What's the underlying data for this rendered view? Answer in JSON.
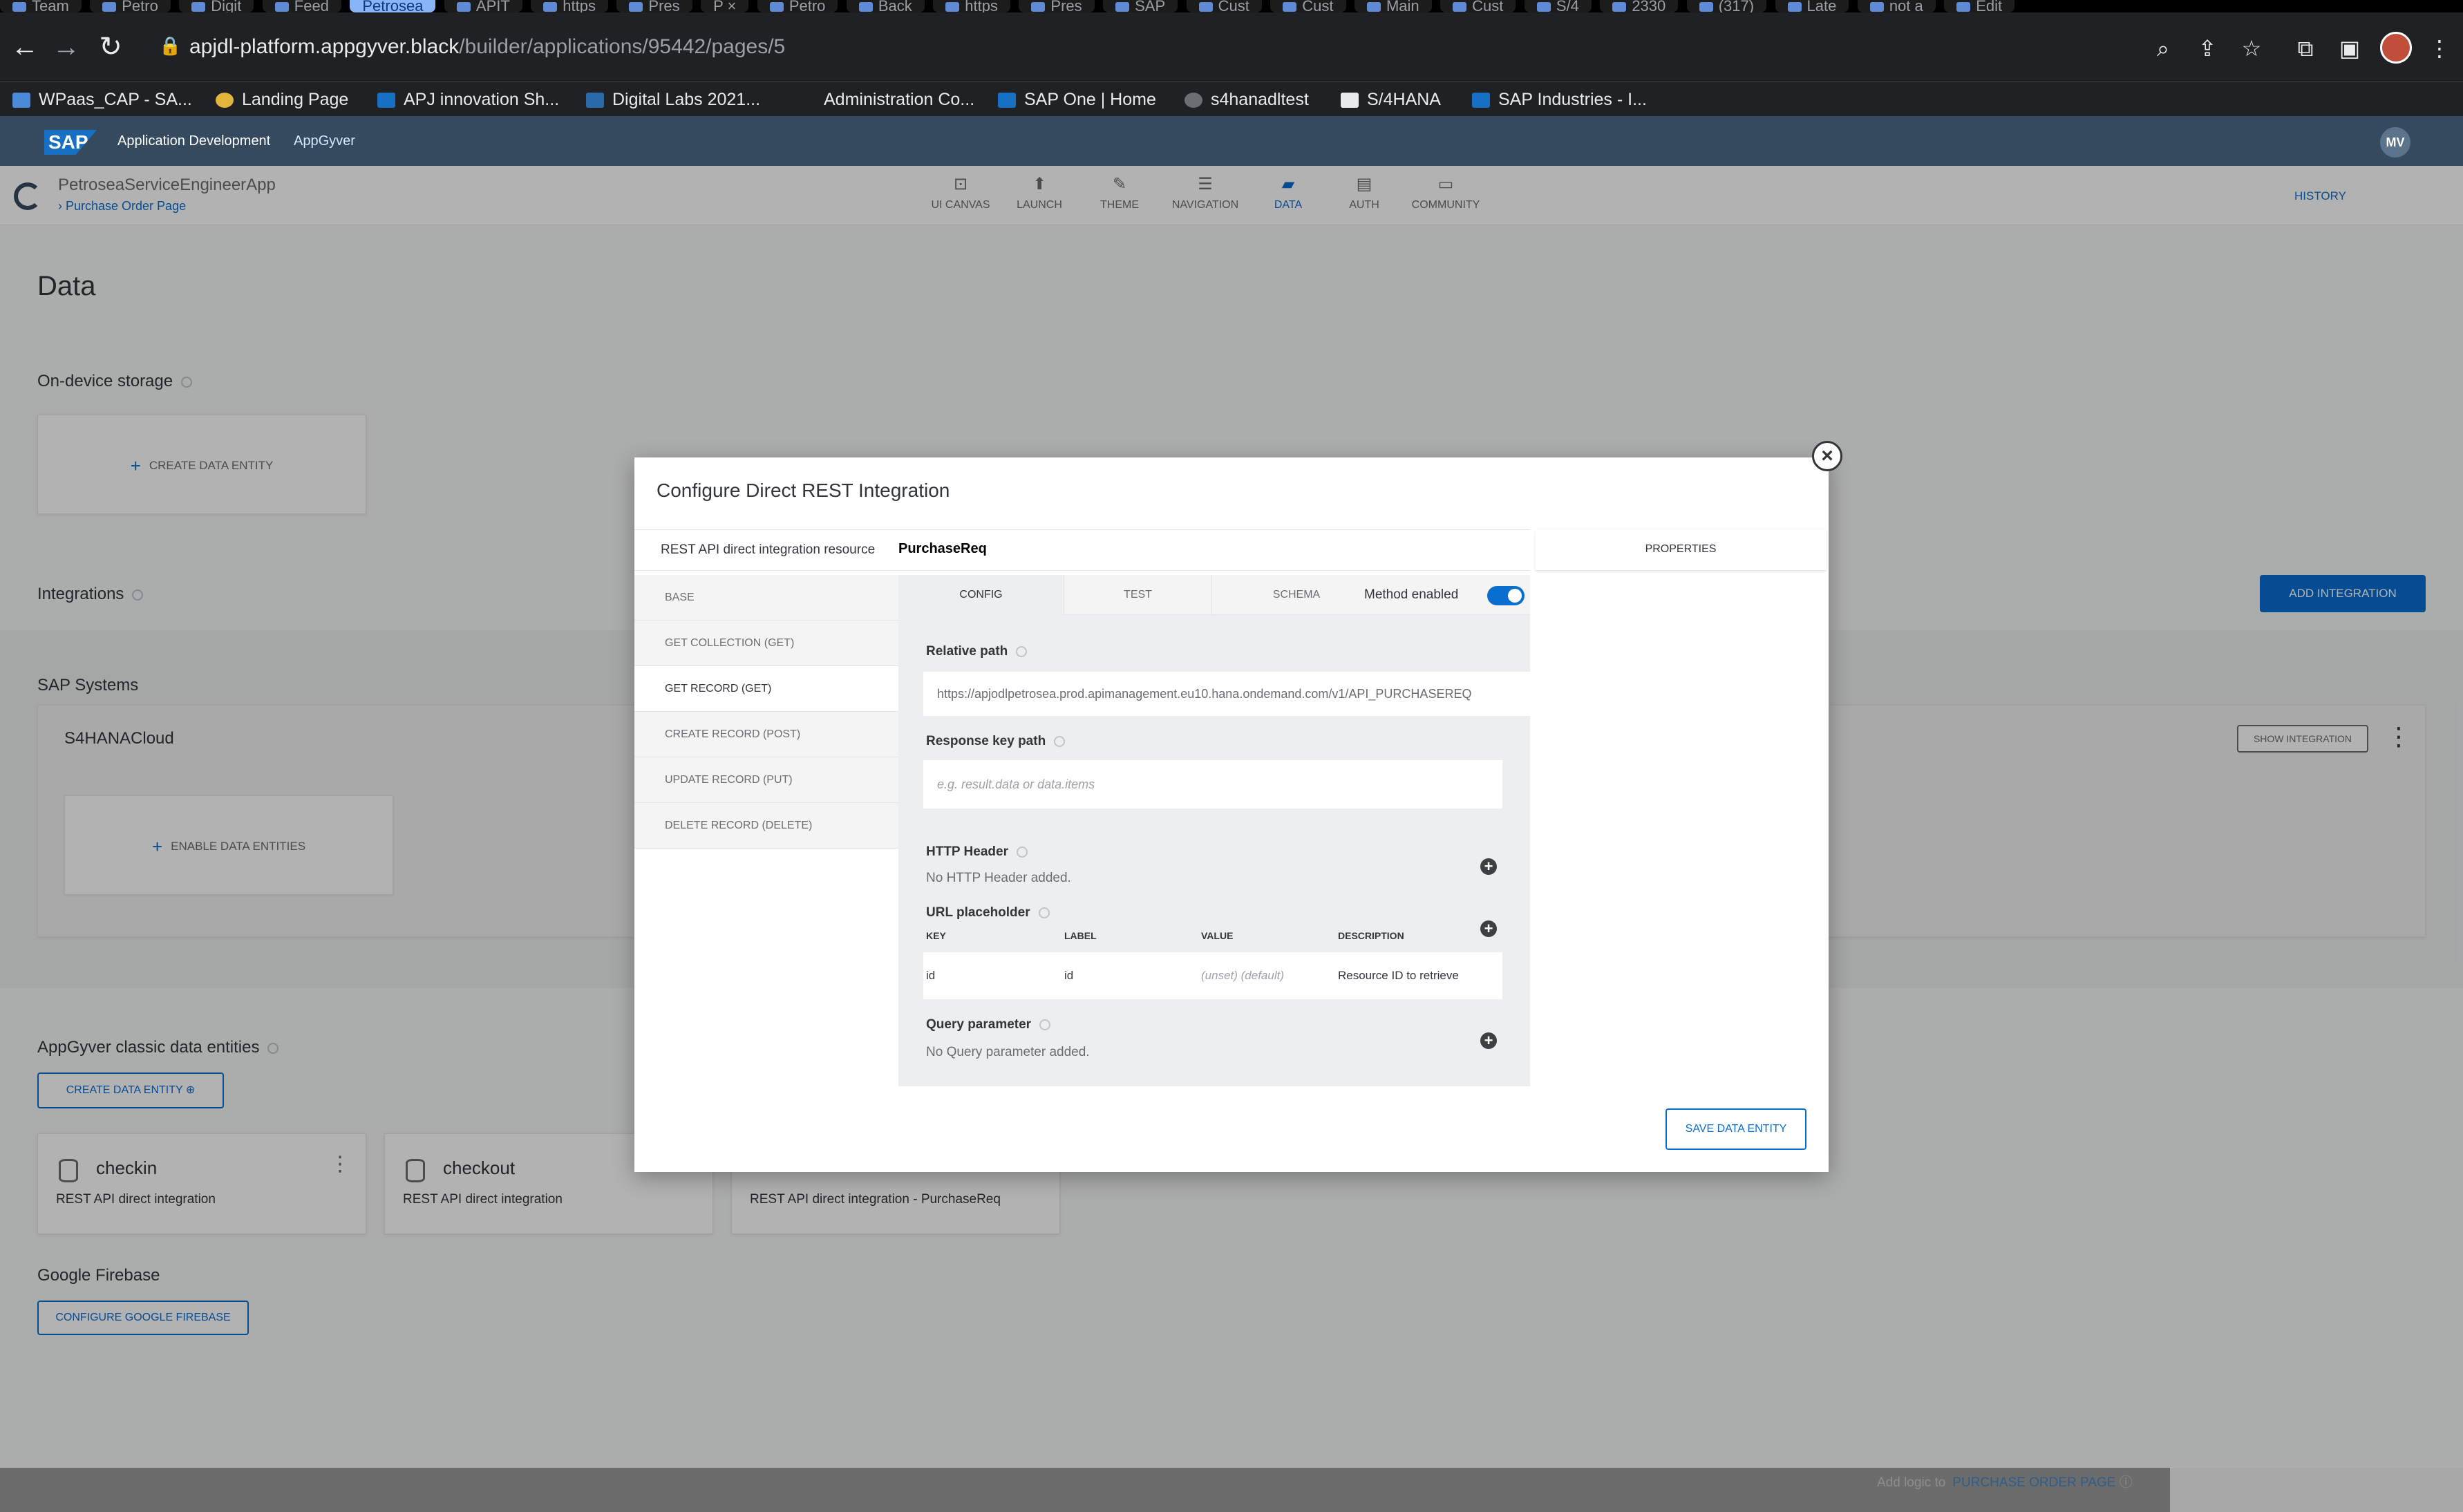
{
  "browser": {
    "tabs": [
      "Team",
      "Petro",
      "Digit",
      "Feed",
      "Petrosea",
      "APIT",
      "https",
      "Pres",
      "P",
      "Petro",
      "Back",
      "https",
      "Pres",
      "SAP",
      "Cust",
      "Cust",
      "Main",
      "Cust",
      "S/4",
      "2330",
      "(317)",
      "Late",
      "not a",
      "Edit"
    ],
    "url_host": "apjdl-platform.appgyver.black",
    "url_path": "/builder/applications/95442/pages/5",
    "bookmarks": [
      "WPaas_CAP - SA...",
      "Landing Page",
      "APJ innovation Sh...",
      "Digital Labs 2021...",
      "Administration Co...",
      "SAP One | Home",
      "s4hanadltest",
      "S/4HANA",
      "SAP Industries - I..."
    ]
  },
  "shell": {
    "logo": "SAP",
    "title": "Application Development",
    "subtitle": "AppGyver",
    "user_initials": "MV"
  },
  "app": {
    "name": "PetroseaServiceEngineerApp",
    "page": "Purchase Order Page",
    "nav": [
      "UI CANVAS",
      "LAUNCH",
      "THEME",
      "NAVIGATION",
      "DATA",
      "AUTH",
      "COMMUNITY"
    ],
    "history": "HISTORY"
  },
  "page": {
    "title": "Data",
    "on_device_storage": "On-device storage",
    "create_data_entity": "CREATE DATA ENTITY",
    "integrations": "Integrations",
    "add_integration": "ADD INTEGRATION",
    "sap_systems": "SAP Systems",
    "system_name": "S4HANACloud",
    "show_integration": "SHOW INTEGRATION",
    "enable_data_entities": "ENABLE DATA ENTITIES",
    "classic_entities": "AppGyver classic data entities",
    "create_data_entity_btn": "CREATE DATA ENTITY",
    "entities": [
      {
        "name": "checkin",
        "desc": "REST API direct integration"
      },
      {
        "name": "checkout",
        "desc": "REST API direct integration"
      },
      {
        "name": "",
        "desc": "REST API direct integration - PurchaseReq"
      }
    ],
    "google_firebase": "Google Firebase",
    "configure_firebase": "CONFIGURE GOOGLE FIREBASE",
    "footer_add_logic": "Add logic to",
    "footer_page": "PURCHASE ORDER PAGE"
  },
  "modal": {
    "title": "Configure Direct REST Integration",
    "resource_label": "REST API direct integration resource",
    "resource_value": "PurchaseReq",
    "properties_tab": "PROPERTIES",
    "methods": [
      "BASE",
      "GET COLLECTION (GET)",
      "GET RECORD (GET)",
      "CREATE RECORD (POST)",
      "UPDATE RECORD (PUT)",
      "DELETE RECORD (DELETE)"
    ],
    "subtabs": [
      "CONFIG",
      "TEST",
      "SCHEMA"
    ],
    "method_enabled": "Method enabled",
    "relative_path_label": "Relative path",
    "relative_path_value": "https://apjodlpetrosea.prod.apimanagement.eu10.hana.ondemand.com/v1/API_PURCHASEREQ",
    "response_key_label": "Response key path",
    "response_key_placeholder": "e.g. result.data or data.items",
    "http_header_label": "HTTP Header",
    "http_header_empty": "No HTTP Header added.",
    "url_placeholder_label": "URL placeholder",
    "columns": [
      "KEY",
      "LABEL",
      "VALUE",
      "DESCRIPTION"
    ],
    "row": {
      "key": "id",
      "label": "id",
      "value": "(unset) (default)",
      "description": "Resource ID to retrieve"
    },
    "query_param_label": "Query parameter",
    "query_param_empty": "No Query parameter added.",
    "save_button": "SAVE DATA ENTITY",
    "close_icon": "×"
  },
  "colors": {
    "accent": "#0a6ed1",
    "shell": "#354a5f"
  }
}
